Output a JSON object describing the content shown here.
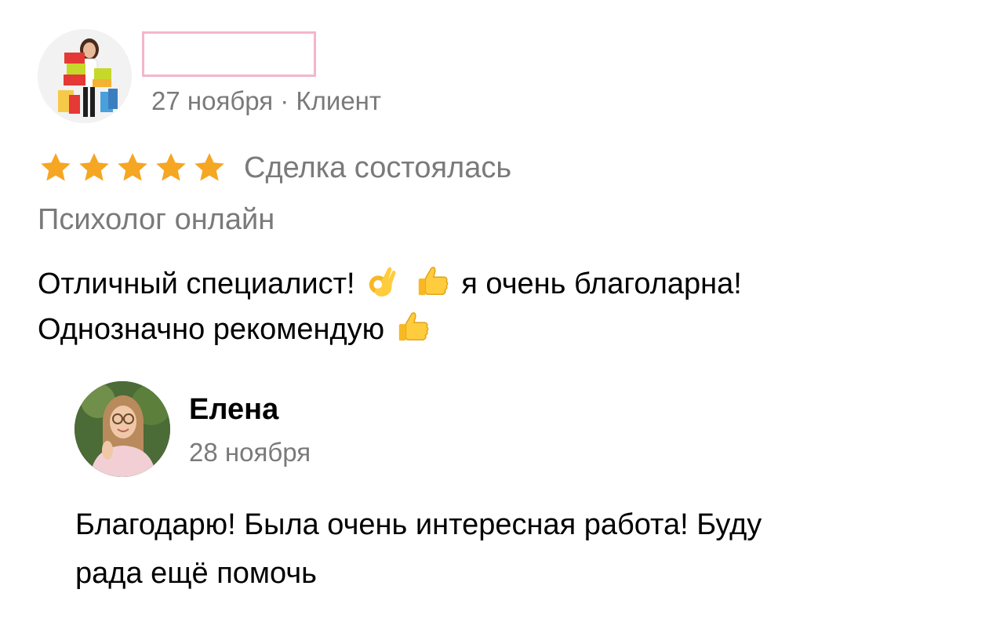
{
  "review": {
    "avatar_icon": "reviewer-avatar-shopping-woman",
    "meta": "27 ноября · Клиент",
    "rating": {
      "stars": 5,
      "max": 5,
      "star_color": "#f5a623",
      "status": "Сделка состоялась"
    },
    "service": "Психолог онлайн",
    "text": {
      "line1_part1": "Отличный специалист!",
      "line1_emoji1": "ok-hand-emoji",
      "line1_emoji2": "thumbs-up-emoji",
      "line1_part2": "я очень благоларна!",
      "line2_part1": "Однозначно рекомендую",
      "line2_emoji": "thumbs-up-emoji"
    }
  },
  "reply": {
    "avatar_icon": "reply-avatar-woman-glasses",
    "name": "Елена",
    "date": "28 ноября",
    "text_line1": "Благодарю! Была очень интересная работа! Буду",
    "text_line2": "рада ещё помочь"
  },
  "colors": {
    "muted_text": "#7a7a7a",
    "name_redaction_border": "#f4b6cc"
  }
}
